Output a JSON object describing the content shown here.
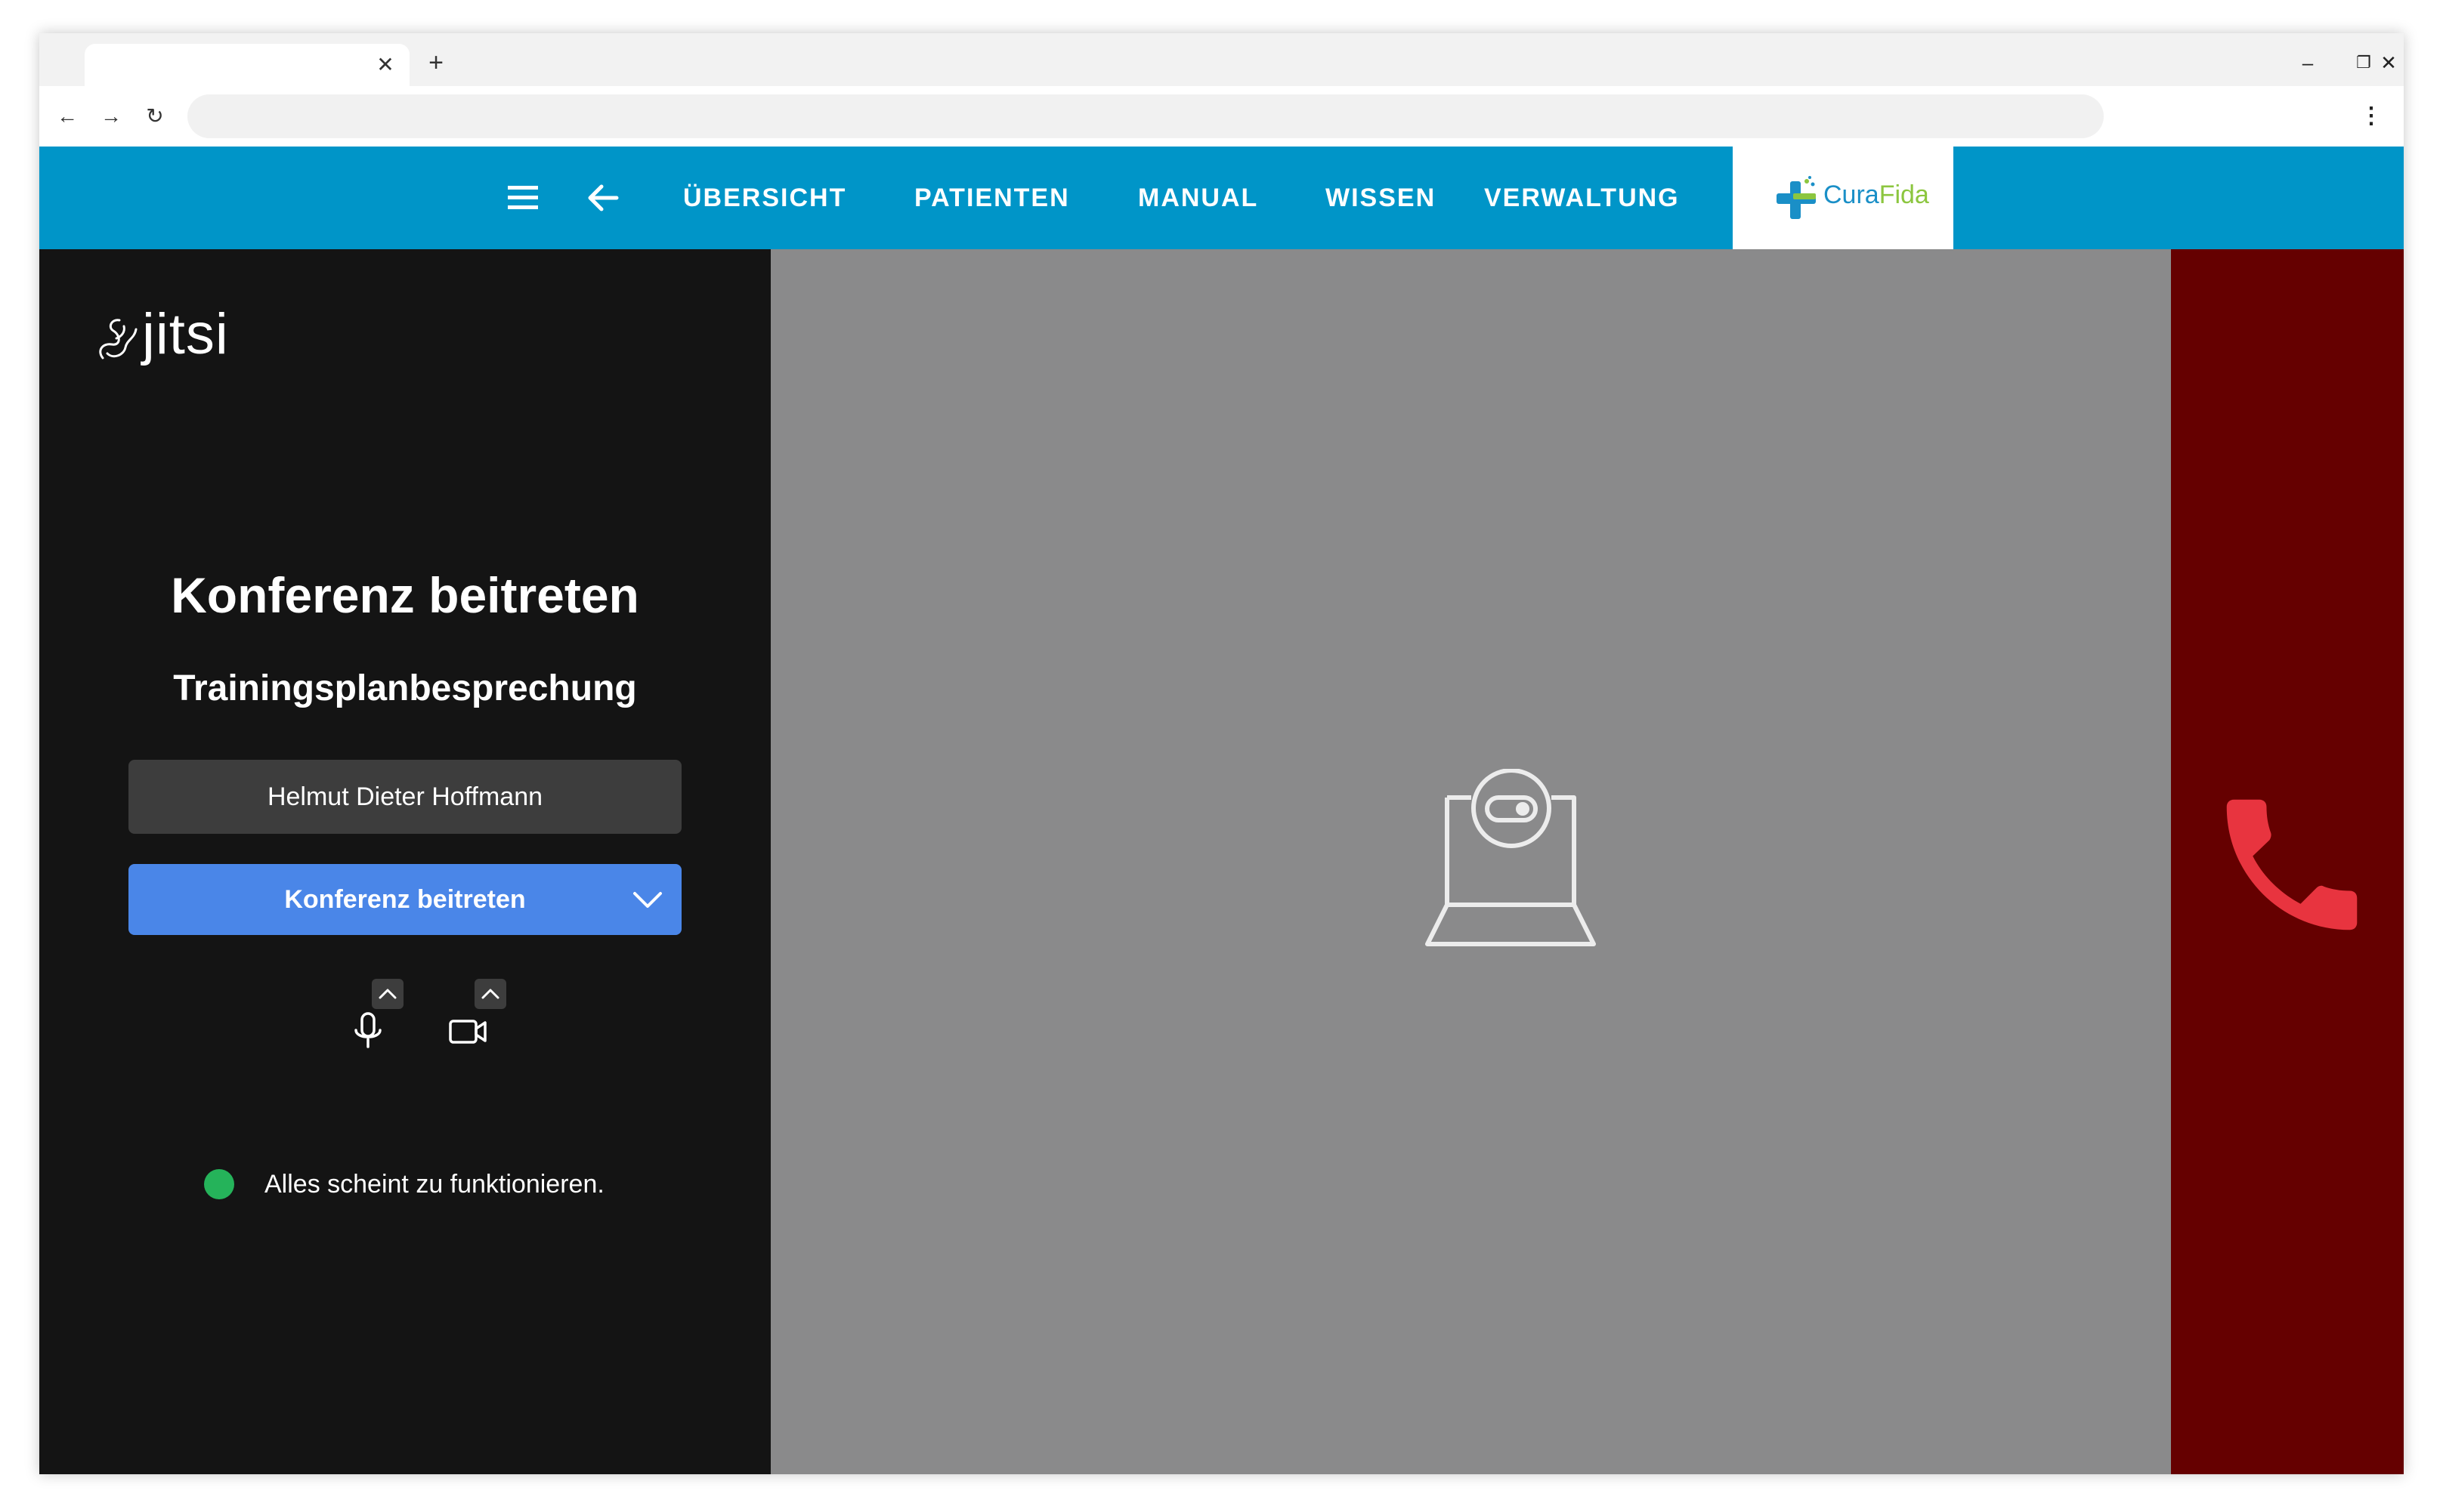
{
  "browser": {
    "tab": {
      "title": "",
      "close_glyph": "✕"
    },
    "new_tab_glyph": "+",
    "window_controls": {
      "minimize": "–",
      "restore": "❐",
      "close": "✕"
    },
    "nav": {
      "back": "←",
      "forward": "→",
      "reload": "↻"
    },
    "address": {
      "value": "",
      "placeholder": ""
    },
    "menu_glyph": "⋮"
  },
  "header": {
    "bg_color": "#0095c8",
    "nav_items": [
      "ÜBERSICHT",
      "PATIENTEN",
      "MANUAL",
      "WISSEN",
      "VERWALTUNG"
    ],
    "logo": {
      "part1": "Cura",
      "part2": "Fida"
    },
    "icons": [
      "menu-icon",
      "arrow-left-icon"
    ]
  },
  "jitsi": {
    "logo_text": "jitsi",
    "title": "Konferenz beitreten",
    "meeting_name": "Trainingsplanbesprechung",
    "display_name": "Helmut Dieter Hoffmann",
    "join_button": "Konferenz beitreten",
    "status_text": "Alles scheint zu funktionieren.",
    "status_color": "#25b35a",
    "join_color": "#4a86e8",
    "icons": [
      "microphone-icon",
      "video-camera-icon",
      "chevron-up-icon",
      "chevron-down-icon"
    ]
  },
  "preview": {
    "bg_color": "#8a8a8b",
    "icon": "webcam-off-icon"
  },
  "hangup": {
    "bg_color": "#650000",
    "icon_color": "#e8343f",
    "icon": "phone-icon"
  }
}
